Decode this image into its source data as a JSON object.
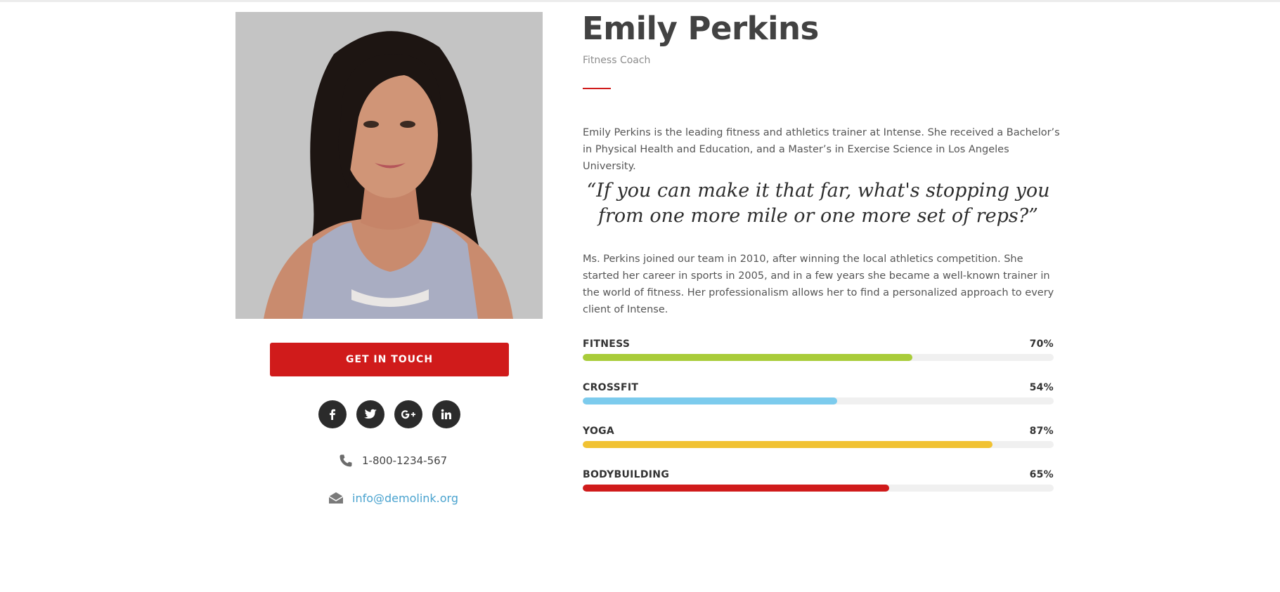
{
  "profile": {
    "name": "Emily Perkins",
    "role": "Fitness Coach",
    "bio_1": "Emily Perkins is the leading fitness and athletics trainer at Intense. She received a Bachelor’s in Physical Health and Education, and a Master’s in Exercise Science in Los Angeles University.",
    "quote": "“If you can make it that far, what's stopping you from one more mile or one more set of reps?”",
    "bio_2": "Ms. Perkins joined our team in 2010, after winning the local athletics competition. She started her career in sports in 2005, and in a few years she became a well-known trainer in the world of fitness. Her professionalism allows her to find a personalized approach to every client of Intense."
  },
  "cta": {
    "label": "GET IN TOUCH"
  },
  "social": [
    {
      "icon": "facebook-icon"
    },
    {
      "icon": "twitter-icon"
    },
    {
      "icon": "google-plus-icon"
    },
    {
      "icon": "linkedin-icon"
    }
  ],
  "contact": {
    "phone": "1-800-1234-567",
    "email": "info@demolink.org"
  },
  "skills": [
    {
      "label": "FITNESS",
      "percent_text": "70%",
      "value": 70,
      "color": "#a9cc3a"
    },
    {
      "label": "CROSSFIT",
      "percent_text": "54%",
      "value": 54,
      "color": "#7ccbed"
    },
    {
      "label": "YOGA",
      "percent_text": "87%",
      "value": 87,
      "color": "#f1c232"
    },
    {
      "label": "BODYBUILDING",
      "percent_text": "65%",
      "value": 65,
      "color": "#d01b1b"
    }
  ],
  "colors": {
    "accent": "#d01b1b",
    "link": "#4aa3cf",
    "dark": "#2b2b2b"
  }
}
